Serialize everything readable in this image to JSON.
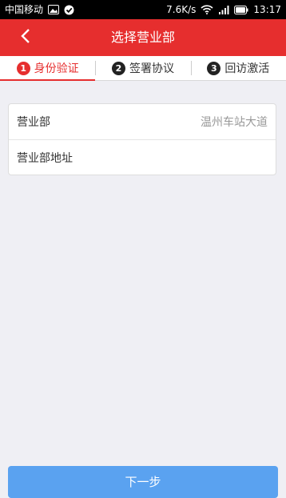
{
  "status_bar": {
    "carrier": "中国移动",
    "speed": "7.6K/s",
    "time": "13:17",
    "icons": [
      "image-icon",
      "check-circle-icon",
      "wifi-icon",
      "signal-icon",
      "battery-icon"
    ]
  },
  "nav": {
    "title": "选择营业部",
    "back_icon": "chevron-left-icon"
  },
  "steps": [
    {
      "number": "1",
      "label": "身份验证",
      "active": true
    },
    {
      "number": "2",
      "label": "签署协议",
      "active": false
    },
    {
      "number": "3",
      "label": "回访激活",
      "active": false
    }
  ],
  "form": {
    "branch_label": "营业部",
    "branch_value": "温州车站大道",
    "address_label": "营业部地址",
    "address_value": ""
  },
  "next_button": {
    "label": "下一步"
  },
  "colors": {
    "brand_red": "#e62e2e",
    "button_blue": "#5aa2f0",
    "background": "#efeff4"
  }
}
